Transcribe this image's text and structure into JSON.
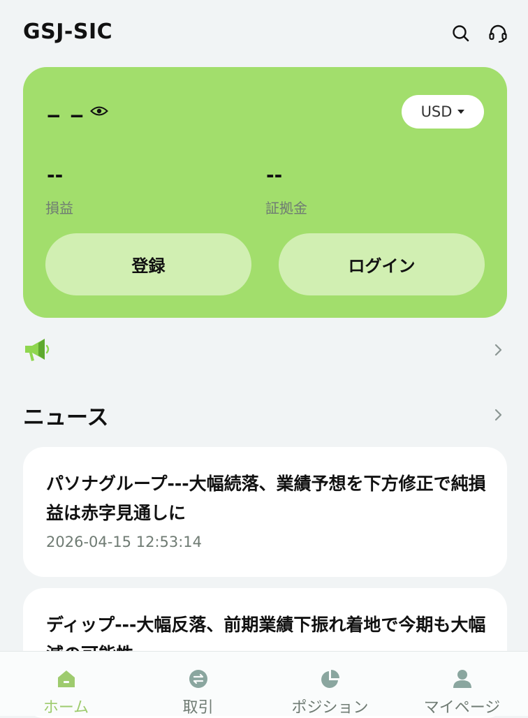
{
  "app": {
    "title": "GSJ-SIC"
  },
  "colors": {
    "accent": "#a2de6c",
    "button_bg": "#d1efb2",
    "icon_muted": "#8aa69f",
    "icon_active": "#9ecb6e",
    "page_bg": "#f1f4f5"
  },
  "header": {
    "icons": [
      "search-icon",
      "headset-icon"
    ]
  },
  "account_card": {
    "balance": "‒ ‒",
    "currency": "USD",
    "pnl_value": "--",
    "pnl_label": "損益",
    "margin_value": "--",
    "margin_label": "証拠金",
    "register_label": "登録",
    "login_label": "ログイン"
  },
  "news": {
    "section_title": "ニュース",
    "items": [
      {
        "title": "パソナグループ---大幅続落、業績予想を下方修正で純損益は赤字見通しに",
        "time": "2026-04-15 12:53:14"
      },
      {
        "title": "ディップ---大幅反落、前期業績下振れ着地で今期も大幅減の可能性"
      }
    ]
  },
  "tabbar": {
    "tabs": [
      {
        "label": "ホーム",
        "icon": "home-icon",
        "active": true
      },
      {
        "label": "取引",
        "icon": "trade-swap-icon"
      },
      {
        "label": "ポジション",
        "icon": "pie-chart-icon"
      },
      {
        "label": "マイページ",
        "icon": "user-icon"
      }
    ]
  }
}
